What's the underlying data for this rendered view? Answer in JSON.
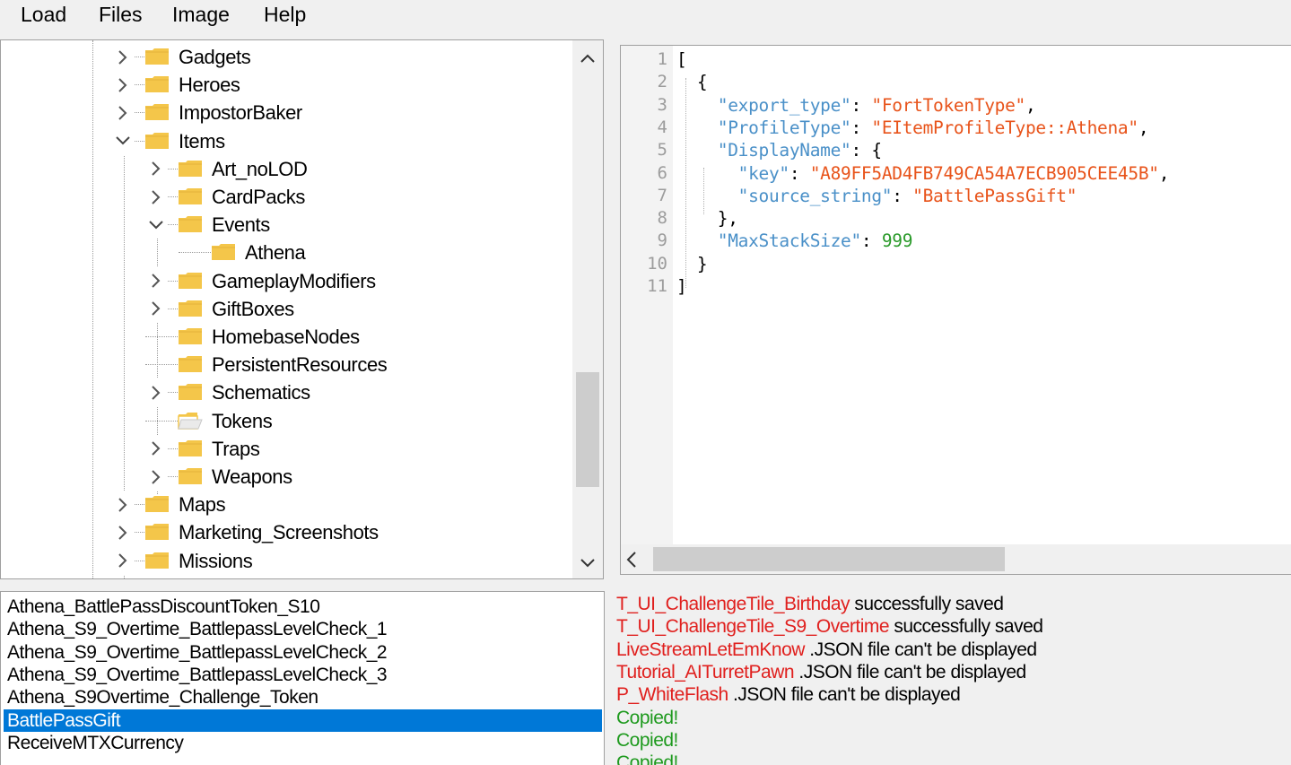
{
  "menu": [
    "Load",
    "Files",
    "Image",
    "Help"
  ],
  "tree": [
    {
      "label": "Gadgets",
      "state": "collapsed",
      "depth": 0
    },
    {
      "label": "Heroes",
      "state": "collapsed",
      "depth": 0
    },
    {
      "label": "ImpostorBaker",
      "state": "collapsed",
      "depth": 0
    },
    {
      "label": "Items",
      "state": "expanded",
      "depth": 0
    },
    {
      "label": "Art_noLOD",
      "state": "collapsed",
      "depth": 1
    },
    {
      "label": "CardPacks",
      "state": "collapsed",
      "depth": 1
    },
    {
      "label": "Events",
      "state": "expanded",
      "depth": 1
    },
    {
      "label": "Athena",
      "state": "leaf",
      "depth": 2
    },
    {
      "label": "GameplayModifiers",
      "state": "collapsed",
      "depth": 1
    },
    {
      "label": "GiftBoxes",
      "state": "collapsed",
      "depth": 1
    },
    {
      "label": "HomebaseNodes",
      "state": "leaf",
      "depth": 1
    },
    {
      "label": "PersistentResources",
      "state": "leaf",
      "depth": 1
    },
    {
      "label": "Schematics",
      "state": "collapsed",
      "depth": 1
    },
    {
      "label": "Tokens",
      "state": "leaf-open",
      "depth": 1
    },
    {
      "label": "Traps",
      "state": "collapsed",
      "depth": 1
    },
    {
      "label": "Weapons",
      "state": "collapsed",
      "depth": 1
    },
    {
      "label": "Maps",
      "state": "collapsed",
      "depth": 0
    },
    {
      "label": "Marketing_Screenshots",
      "state": "collapsed",
      "depth": 0
    },
    {
      "label": "Missions",
      "state": "collapsed",
      "depth": 0
    }
  ],
  "editor": {
    "line_numbers": [
      "1",
      "2",
      "3",
      "4",
      "5",
      "6",
      "7",
      "8",
      "9",
      "10",
      "11"
    ],
    "lines": [
      [
        {
          "t": "p",
          "v": "["
        }
      ],
      [
        {
          "t": "p",
          "v": "  {"
        }
      ],
      [
        {
          "t": "k",
          "v": "    \"export_type\""
        },
        {
          "t": "p",
          "v": ": "
        },
        {
          "t": "s",
          "v": "\"FortTokenType\""
        },
        {
          "t": "p",
          "v": ","
        }
      ],
      [
        {
          "t": "k",
          "v": "    \"ProfileType\""
        },
        {
          "t": "p",
          "v": ": "
        },
        {
          "t": "s",
          "v": "\"EItemProfileType::Athena\""
        },
        {
          "t": "p",
          "v": ","
        }
      ],
      [
        {
          "t": "k",
          "v": "    \"DisplayName\""
        },
        {
          "t": "p",
          "v": ": {"
        }
      ],
      [
        {
          "t": "k",
          "v": "      \"key\""
        },
        {
          "t": "p",
          "v": ": "
        },
        {
          "t": "s",
          "v": "\"A89FF5AD4FB749CA54A7ECB905CEE45B\""
        },
        {
          "t": "p",
          "v": ","
        }
      ],
      [
        {
          "t": "k",
          "v": "      \"source_string\""
        },
        {
          "t": "p",
          "v": ": "
        },
        {
          "t": "s",
          "v": "\"BattlePassGift\""
        }
      ],
      [
        {
          "t": "p",
          "v": "    },"
        }
      ],
      [
        {
          "t": "k",
          "v": "    \"MaxStackSize\""
        },
        {
          "t": "p",
          "v": ": "
        },
        {
          "t": "n",
          "v": "999"
        }
      ],
      [
        {
          "t": "p",
          "v": "  }"
        }
      ],
      [
        {
          "t": "p",
          "v": "]"
        }
      ]
    ]
  },
  "files": [
    {
      "label": "Athena_BattlePassDiscountToken_S10",
      "selected": false
    },
    {
      "label": "Athena_S9_Overtime_BattlepassLevelCheck_1",
      "selected": false
    },
    {
      "label": "Athena_S9_Overtime_BattlepassLevelCheck_2",
      "selected": false
    },
    {
      "label": "Athena_S9_Overtime_BattlepassLevelCheck_3",
      "selected": false
    },
    {
      "label": "Athena_S9Overtime_Challenge_Token",
      "selected": false
    },
    {
      "label": "BattlePassGift",
      "selected": true
    },
    {
      "label": "ReceiveMTXCurrency",
      "selected": false
    }
  ],
  "log": [
    {
      "name": "T_UI_ChallengeTile_Birthday",
      "msg": " successfully saved",
      "color": "red"
    },
    {
      "name": "T_UI_ChallengeTile_S9_Overtime",
      "msg": " successfully saved",
      "color": "red"
    },
    {
      "name": "LiveStreamLetEmKnow",
      "msg": " .JSON file can't be displayed",
      "color": "red"
    },
    {
      "name": "Tutorial_AITurretPawn",
      "msg": " .JSON file can't be displayed",
      "color": "red"
    },
    {
      "name": "P_WhiteFlash",
      "msg": " .JSON file can't be displayed",
      "color": "red"
    },
    {
      "name": "Copied!",
      "msg": "",
      "color": "green"
    },
    {
      "name": "Copied!",
      "msg": "",
      "color": "green"
    },
    {
      "name": "Copied!",
      "msg": "",
      "color": "green"
    }
  ],
  "icons": {
    "chevron_right": "chevron-right-icon",
    "chevron_down": "chevron-down-icon",
    "folder": "folder-icon",
    "folder_open": "folder-open-icon",
    "scroll_up": "scroll-up-arrow-icon",
    "scroll_down": "scroll-down-arrow-icon",
    "scroll_left": "scroll-left-arrow-icon"
  },
  "colors": {
    "selection": "#0078d7",
    "folder": "#f4c64a",
    "json_key": "#4a90c8",
    "json_string": "#e8531a",
    "json_number": "#2a9a2a",
    "log_error": "#e0201e",
    "log_success": "#1e9a1e"
  }
}
